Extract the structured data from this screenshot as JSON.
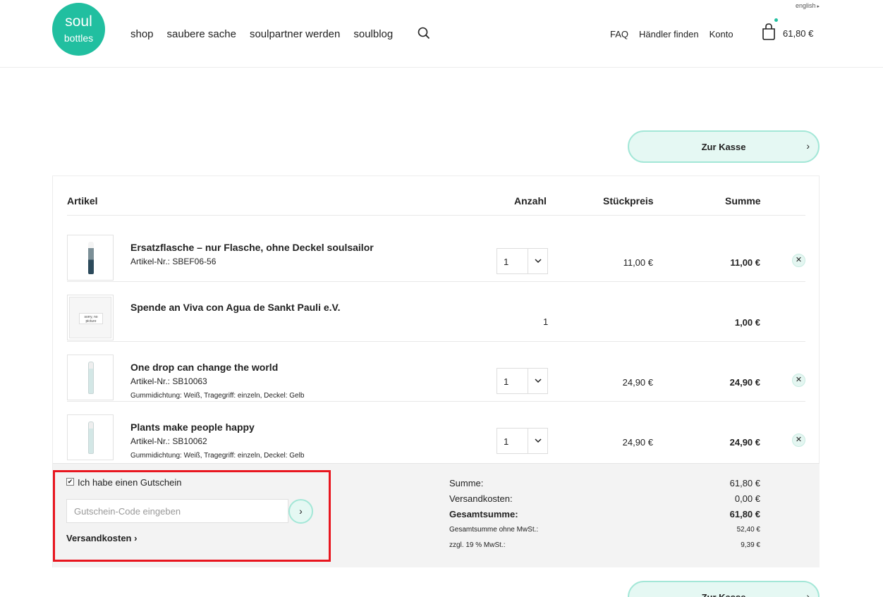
{
  "header": {
    "language": "english",
    "logo": {
      "line1": "soul",
      "line2": "bottles"
    },
    "nav": [
      "shop",
      "saubere sache",
      "soulpartner werden",
      "soulblog"
    ],
    "right_nav": [
      "FAQ",
      "Händler finden",
      "Konto"
    ],
    "cart_total": "61,80 €"
  },
  "checkout_label": "Zur Kasse",
  "table": {
    "headers": {
      "article": "Artikel",
      "qty": "Anzahl",
      "unit_price": "Stückpreis",
      "sum": "Summe"
    },
    "rows": [
      {
        "name": "Ersatzflasche – nur Flasche, ohne Deckel soulsailor",
        "number": "Artikel-Nr.: SBEF06-56",
        "variant": "",
        "qty": "1",
        "unit_price": "11,00 €",
        "sum": "11,00 €"
      },
      {
        "name": "Spende an Viva con Agua de Sankt Pauli e.V.",
        "number": "",
        "variant": "",
        "qty": "1",
        "unit_price": "",
        "sum": "1,00 €",
        "no_picture": "sorry, no picture"
      },
      {
        "name": "One drop can change the world",
        "number": "Artikel-Nr.: SB10063",
        "variant": "Gummidichtung: Weiß, Tragegriff: einzeln, Deckel: Gelb",
        "qty": "1",
        "unit_price": "24,90 €",
        "sum": "24,90 €"
      },
      {
        "name": "Plants make people happy",
        "number": "Artikel-Nr.: SB10062",
        "variant": "Gummidichtung: Weiß, Tragegriff: einzeln, Deckel: Gelb",
        "qty": "1",
        "unit_price": "24,90 €",
        "sum": "24,90 €"
      }
    ]
  },
  "coupon": {
    "checkbox_label": "Ich habe einen Gutschein",
    "placeholder": "Gutschein-Code eingeben",
    "shipping_link": "Versandkosten"
  },
  "totals": {
    "sum_label": "Summe:",
    "sum": "61,80 €",
    "shipping_label": "Versandkosten:",
    "shipping": "0,00 €",
    "grand_label": "Gesamtsumme:",
    "grand": "61,80 €",
    "net_label": "Gesamtsumme ohne MwSt.:",
    "net": "52,40 €",
    "vat_label": "zzgl. 19 % MwSt.:",
    "vat": "9,39 €"
  },
  "colors": {
    "brand": "#21bfa0",
    "button_bg": "#e5f8f3",
    "highlight": "#e8161f"
  }
}
